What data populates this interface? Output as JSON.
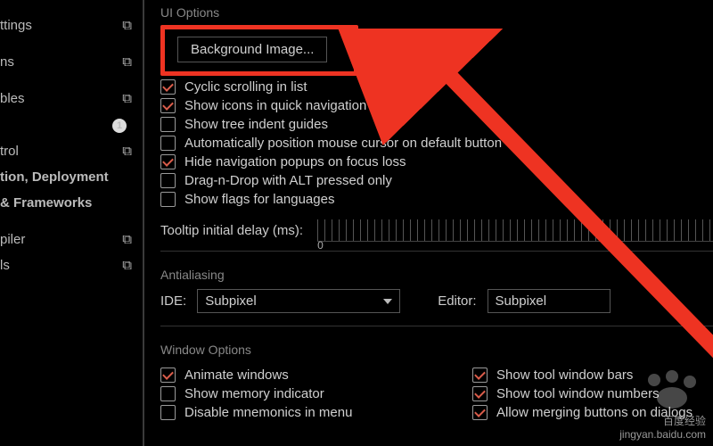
{
  "sidebar": {
    "items": [
      {
        "label": "ttings",
        "icon": true
      },
      {
        "label": " ",
        "icon": false
      },
      {
        "label": "ns",
        "icon": true
      },
      {
        "label": "",
        "icon": false,
        "red": true
      },
      {
        "label": "bles",
        "icon": true
      },
      {
        "label": " ",
        "icon": false,
        "badge": "1"
      },
      {
        "label": "trol",
        "icon": true
      },
      {
        "label": "tion, Deployment",
        "bold": true
      },
      {
        "label": "& Frameworks",
        "bold": true
      },
      {
        "label": " "
      },
      {
        "label": "piler",
        "icon": true
      },
      {
        "label": "ls",
        "icon": true
      }
    ]
  },
  "ui_options": {
    "heading": "UI Options",
    "bg_button": "Background Image...",
    "items": [
      {
        "label": "Cyclic scrolling in list",
        "checked": true
      },
      {
        "label": "Show icons in quick navigation",
        "checked": true
      },
      {
        "label": "Show tree indent guides",
        "checked": false
      },
      {
        "label": "Automatically position mouse cursor on default button",
        "checked": false
      },
      {
        "label": "Hide navigation popups on focus loss",
        "checked": true
      },
      {
        "label": "Drag-n-Drop with ALT pressed only",
        "checked": false
      },
      {
        "label": "Show flags for languages",
        "checked": false
      }
    ]
  },
  "tooltip": {
    "label": "Tooltip initial delay (ms):",
    "zero": "0"
  },
  "antialiasing": {
    "heading": "Antialiasing",
    "ide_label": "IDE:",
    "ide_value": "Subpixel",
    "editor_label": "Editor:",
    "editor_value": "Subpixel"
  },
  "window_options": {
    "heading": "Window Options",
    "left": [
      {
        "label": "Animate windows",
        "checked": true
      },
      {
        "label": "Show memory indicator",
        "checked": false
      },
      {
        "label": "Disable mnemonics in menu",
        "checked": false
      }
    ],
    "right": [
      {
        "label": "Show tool window bars",
        "checked": true
      },
      {
        "label": "Show tool window numbers",
        "checked": true
      },
      {
        "label": "Allow merging buttons on dialogs",
        "checked": true
      }
    ]
  },
  "watermark": {
    "line1": "百度经验",
    "line2": "jingyan.baidu.com"
  }
}
